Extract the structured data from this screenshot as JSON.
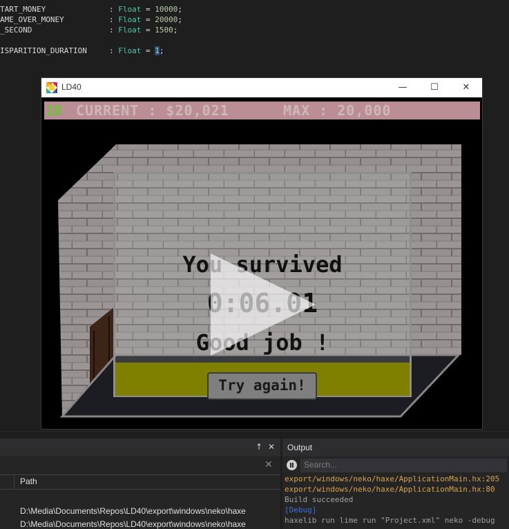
{
  "editor": {
    "lines": [
      {
        "name": "START_MONEY",
        "type": "Float",
        "value": "10000"
      },
      {
        "name": "GAME_OVER_MONEY",
        "type": "Float",
        "value": "20000"
      },
      {
        "name": "PER_SECOND",
        "type": "Float",
        "value": "1500"
      },
      {
        "name": "DISPARITION_DURATION",
        "type": "Float",
        "value": "1"
      }
    ],
    "line_texts": [
      "TART_MONEY",
      "AME_OVER_MONEY",
      "_SECOND",
      "ISPARITION_DURATION"
    ]
  },
  "window": {
    "title": "LD40",
    "minimize_glyph": "—",
    "maximize_glyph": "☐",
    "close_glyph": "✕"
  },
  "hud": {
    "level": "10",
    "current_label": "CURRENT : $20,021",
    "max_label": "MAX : 20,000"
  },
  "game_over": {
    "headline": "You survived",
    "time": "0:06.01",
    "message": "Good job !",
    "try_again": "Try again!"
  },
  "left_panel": {
    "pin_glyph": "↑",
    "close_glyph": "✕",
    "clear_glyph": "✕",
    "column_header": "Path",
    "rows": [
      "D:\\Media\\Documents\\Repos\\LD40\\export\\windows\\neko\\haxe",
      "D:\\Media\\Documents\\Repos\\LD40\\export\\windows\\neko\\haxe"
    ]
  },
  "output_panel": {
    "title": "Output",
    "search_placeholder": "Search...",
    "lines": [
      {
        "text": "export/windows/neko/haxe/ApplicationMain.hx:205",
        "color": "#d7a34c"
      },
      {
        "text": "export/windows/neko/haxe/ApplicationMain.hx:80",
        "color": "#d7a34c"
      },
      {
        "text": "Build succeeded",
        "color": "#a0a0a0"
      },
      {
        "text": "[Debug]",
        "color": "#3f6fd6"
      },
      {
        "text": "haxelib run lime run \"Project.xml\" neko -debug",
        "color": "#a0a0a0"
      }
    ]
  },
  "colors": {
    "hud_bar": "#ba8e94",
    "level_text": "#6ec23a",
    "yellow_bar": "#808000",
    "code_type": "#4ec9b0",
    "code_number": "#b5cea8"
  }
}
